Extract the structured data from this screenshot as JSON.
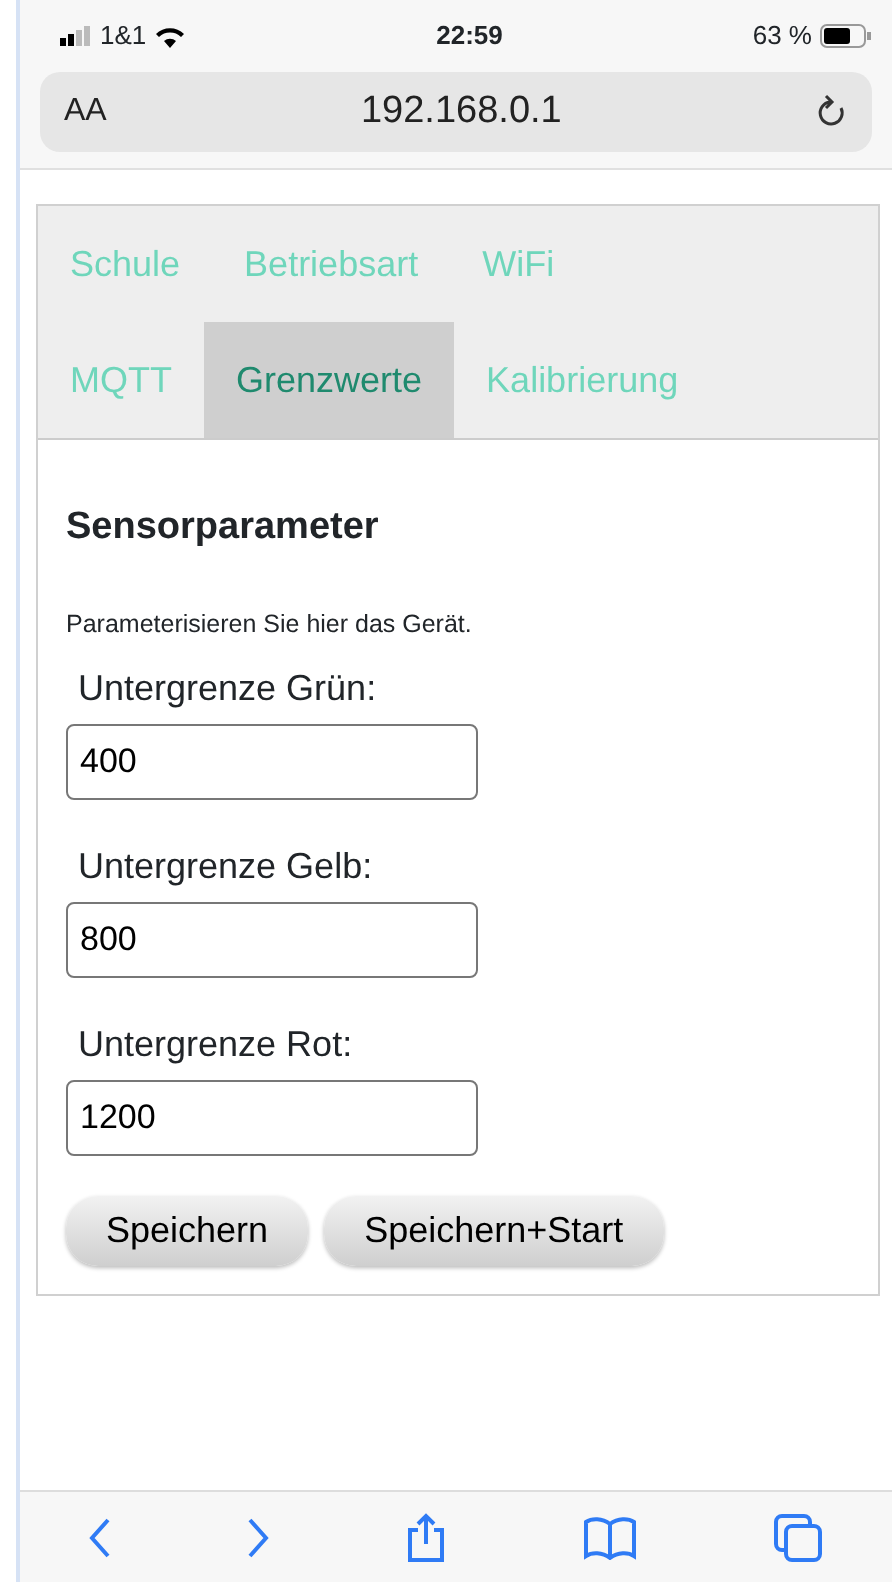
{
  "status_bar": {
    "carrier": "1&1",
    "time": "22:59",
    "battery": "63 %"
  },
  "address_bar": {
    "text_size": "AA",
    "url": "192.168.0.1"
  },
  "tabs": [
    {
      "label": "Schule",
      "selected": false
    },
    {
      "label": "Betriebsart",
      "selected": false
    },
    {
      "label": "WiFi",
      "selected": false
    },
    {
      "label": "MQTT",
      "selected": false
    },
    {
      "label": "Grenzwerte",
      "selected": true
    },
    {
      "label": "Kalibrierung",
      "selected": false
    }
  ],
  "heading": "Sensorparameter",
  "description": "Parameterisieren Sie hier das Gerät.",
  "fields": [
    {
      "label": "Untergrenze Grün:",
      "value": "400"
    },
    {
      "label": "Untergrenze Gelb:",
      "value": "800"
    },
    {
      "label": "Untergrenze Rot:",
      "value": "1200"
    }
  ],
  "buttons": [
    "Speichern",
    "Speichern+Start"
  ]
}
